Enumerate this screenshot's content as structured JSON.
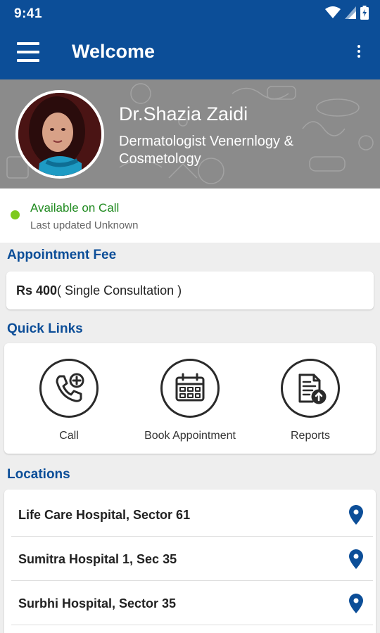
{
  "status_bar": {
    "time": "9:41",
    "icons": [
      "wifi-icon",
      "signal-icon",
      "battery-icon"
    ]
  },
  "toolbar": {
    "title": "Welcome",
    "menu_icon": "hamburger-menu-icon",
    "overflow_icon": "more-vert-icon"
  },
  "doctor": {
    "name": "Dr.Shazia Zaidi",
    "specialization": "Dermatologist Venernlogy & Cosmetology"
  },
  "availability": {
    "status": "Available on Call",
    "updated": "Last updated Unknown",
    "status_color": "#7ec91e"
  },
  "fee": {
    "title": "Appointment Fee",
    "amount": "Rs 400",
    "description": "( Single Consultation )"
  },
  "quick_links": {
    "title": "Quick Links",
    "items": [
      {
        "label": "Call",
        "icon": "phone-plus-icon"
      },
      {
        "label": "Book Appointment",
        "icon": "calendar-icon"
      },
      {
        "label": "Reports",
        "icon": "report-upload-icon"
      }
    ]
  },
  "locations": {
    "title": "Locations",
    "items": [
      {
        "name": "Life Care Hospital, Sector 61",
        "icon": "location-pin-icon"
      },
      {
        "name": "Sumitra Hospital 1, Sec 35",
        "icon": "location-pin-icon"
      },
      {
        "name": "Surbhi Hospital, Sector 35",
        "icon": "location-pin-icon"
      }
    ]
  },
  "colors": {
    "primary": "#0c4e98",
    "background": "#eeeeee",
    "available": "#7ec91e"
  }
}
